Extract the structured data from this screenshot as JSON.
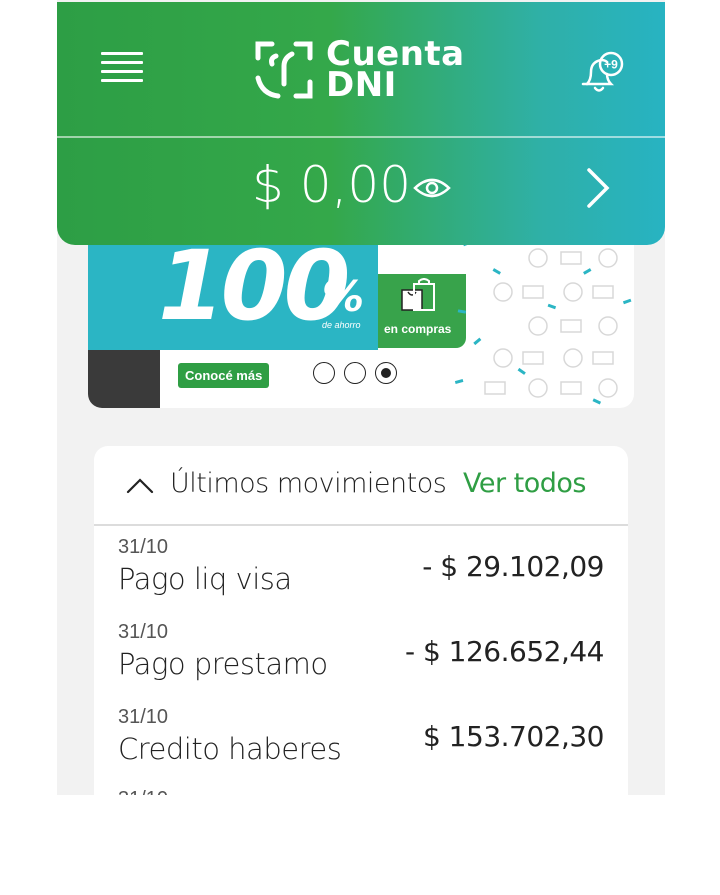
{
  "header": {
    "logo_line1": "Cuenta",
    "logo_line2": "DNI",
    "notification_badge": "+9",
    "balance": "$ 0,00"
  },
  "banner": {
    "headline": "100",
    "percent": "%",
    "savings_label": "de ahorro",
    "purchases_label": "en compras",
    "cta_label": "Conocé más",
    "slides": 3,
    "active_slide": 3
  },
  "movements": {
    "title": "Últimos movimientos",
    "view_all": "Ver todos",
    "items": [
      {
        "date": "31/10",
        "description": "Pago liq visa",
        "amount": "- $ 29.102,09"
      },
      {
        "date": "31/10",
        "description": "Pago prestamo",
        "amount": "- $ 126.652,44"
      },
      {
        "date": "31/10",
        "description": "Credito haberes",
        "amount": "$ 153.702,30"
      }
    ]
  },
  "colors": {
    "green": "#2f9e44",
    "teal": "#2bb5c4",
    "text": "#222222"
  }
}
